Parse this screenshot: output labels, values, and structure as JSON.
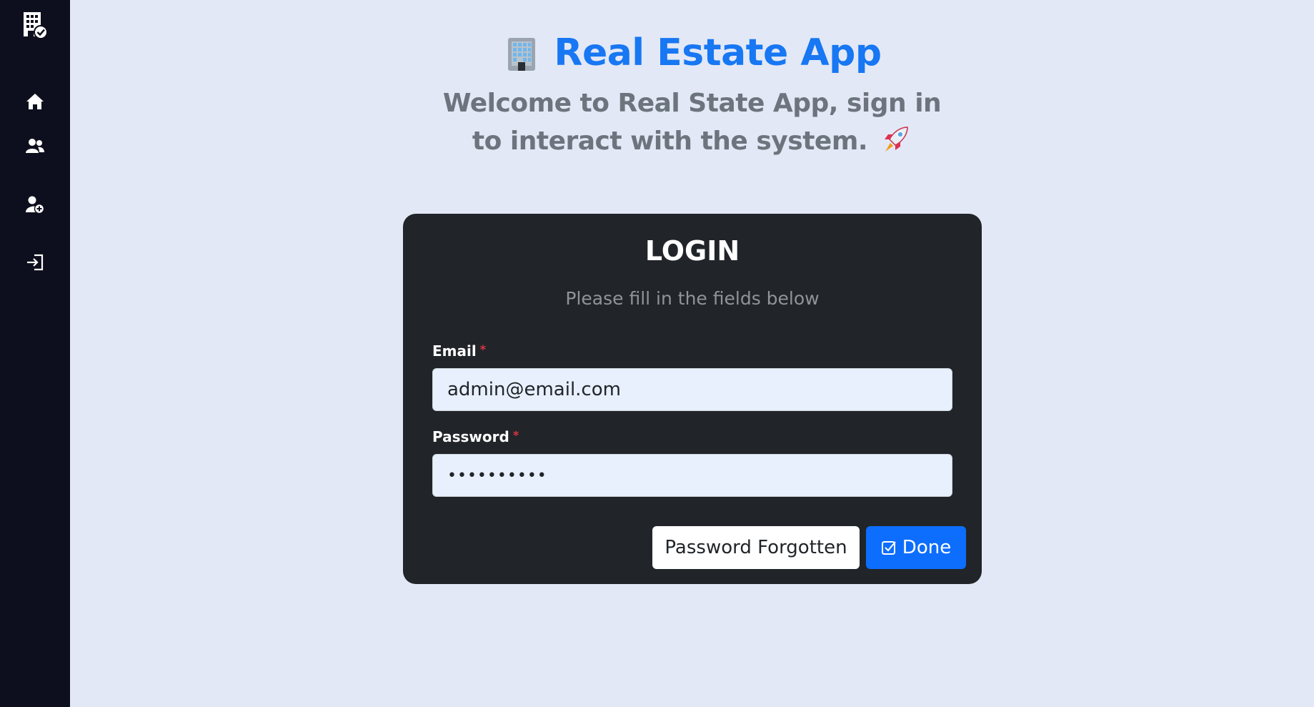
{
  "sidebar": {
    "logo_icon": "building-check-icon",
    "items": [
      {
        "icon": "home-icon"
      },
      {
        "icon": "users-icon"
      },
      {
        "icon": "user-plus-icon"
      },
      {
        "icon": "sign-in-icon"
      }
    ]
  },
  "header": {
    "emoji": "🏢",
    "title": "Real Estate App",
    "subtitle": "Welcome to Real State App, sign in to interact with the system.",
    "subtitle_emoji": "🚀"
  },
  "login": {
    "title": "LOGIN",
    "subtitle": "Please fill in the fields below",
    "email_label": "Email",
    "email_required": "*",
    "email_value": "admin@email.com",
    "password_label": "Password",
    "password_required": "*",
    "password_value": "••••••••••",
    "forgot_label": "Password Forgotten",
    "done_label": "Done"
  },
  "colors": {
    "accent": "#1877f2",
    "primary_button": "#0d6efd",
    "card_bg": "#212529",
    "sidebar_bg": "#0e0f1e",
    "page_bg": "#e3e8f6",
    "required": "#dc3545"
  }
}
